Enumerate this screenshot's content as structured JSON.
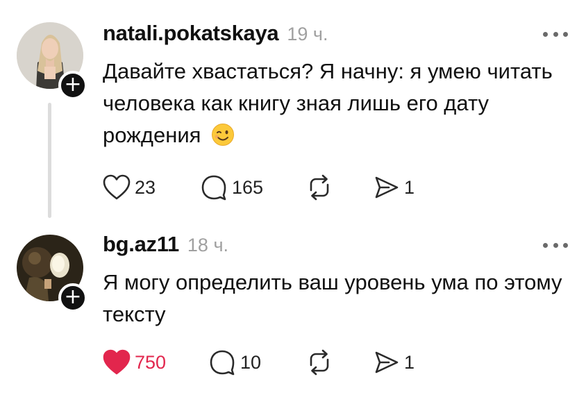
{
  "posts": [
    {
      "username": "natali.pokatskaya",
      "time": "19 ч.",
      "text": "Давайте хвастаться? Я начну: я умею читать человека как книгу зная лишь его дату рождения",
      "emoji": "winking-face",
      "likes": "23",
      "liked": false,
      "comments": "165",
      "shares": "1",
      "follow_badge": "+"
    },
    {
      "username": "bg.az11",
      "time": "18 ч.",
      "text": "Я могу определить ваш уровень ума по этому тексту",
      "likes": "750",
      "liked": true,
      "comments": "10",
      "shares": "1",
      "follow_badge": "+"
    }
  ],
  "colors": {
    "liked": "#e2264d",
    "text": "#111111",
    "muted": "#a0a0a0",
    "thread_line": "#dcdcdc",
    "icon": "#2a2a2a"
  },
  "icons": [
    "heart-icon",
    "comment-icon",
    "repost-icon",
    "send-icon",
    "more-icon",
    "plus-icon"
  ]
}
